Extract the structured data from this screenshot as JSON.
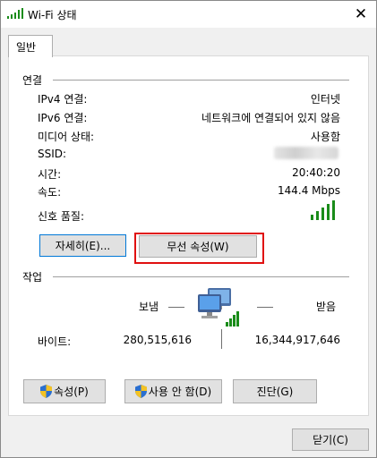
{
  "window": {
    "title": "Wi-Fi 상태",
    "close_glyph": "✕"
  },
  "tabs": [
    {
      "label": "일반"
    }
  ],
  "connection": {
    "group_title": "연결",
    "rows": [
      {
        "label": "IPv4 연결:",
        "value": "인터넷"
      },
      {
        "label": "IPv6 연결:",
        "value": "네트워크에 연결되어 있지 않음"
      },
      {
        "label": "미디어 상태:",
        "value": "사용함"
      },
      {
        "label": "SSID:",
        "value": ""
      },
      {
        "label": "시간:",
        "value": "20:40:20"
      },
      {
        "label": "속도:",
        "value": "144.4 Mbps"
      }
    ],
    "signal_label": "신호 품질:",
    "signal_bars": 5,
    "signal_color": "#1a8c1a",
    "details_button": "자세히(E)...",
    "wireless_props_button": "무선 속성(W)"
  },
  "activity": {
    "group_title": "작업",
    "sent_label": "보냄",
    "received_label": "받음",
    "bytes_label": "바이트:",
    "bytes_sent": "280,515,616",
    "bytes_received": "16,344,917,646"
  },
  "actions": {
    "properties_button": "속성(P)",
    "disable_button": "사용 안 함(D)",
    "diagnose_button": "진단(G)"
  },
  "footer": {
    "close_button": "닫기(C)"
  },
  "colors": {
    "highlight_border": "#e01010",
    "focus_border": "#0078d7",
    "button_face": "#e1e1e1"
  }
}
